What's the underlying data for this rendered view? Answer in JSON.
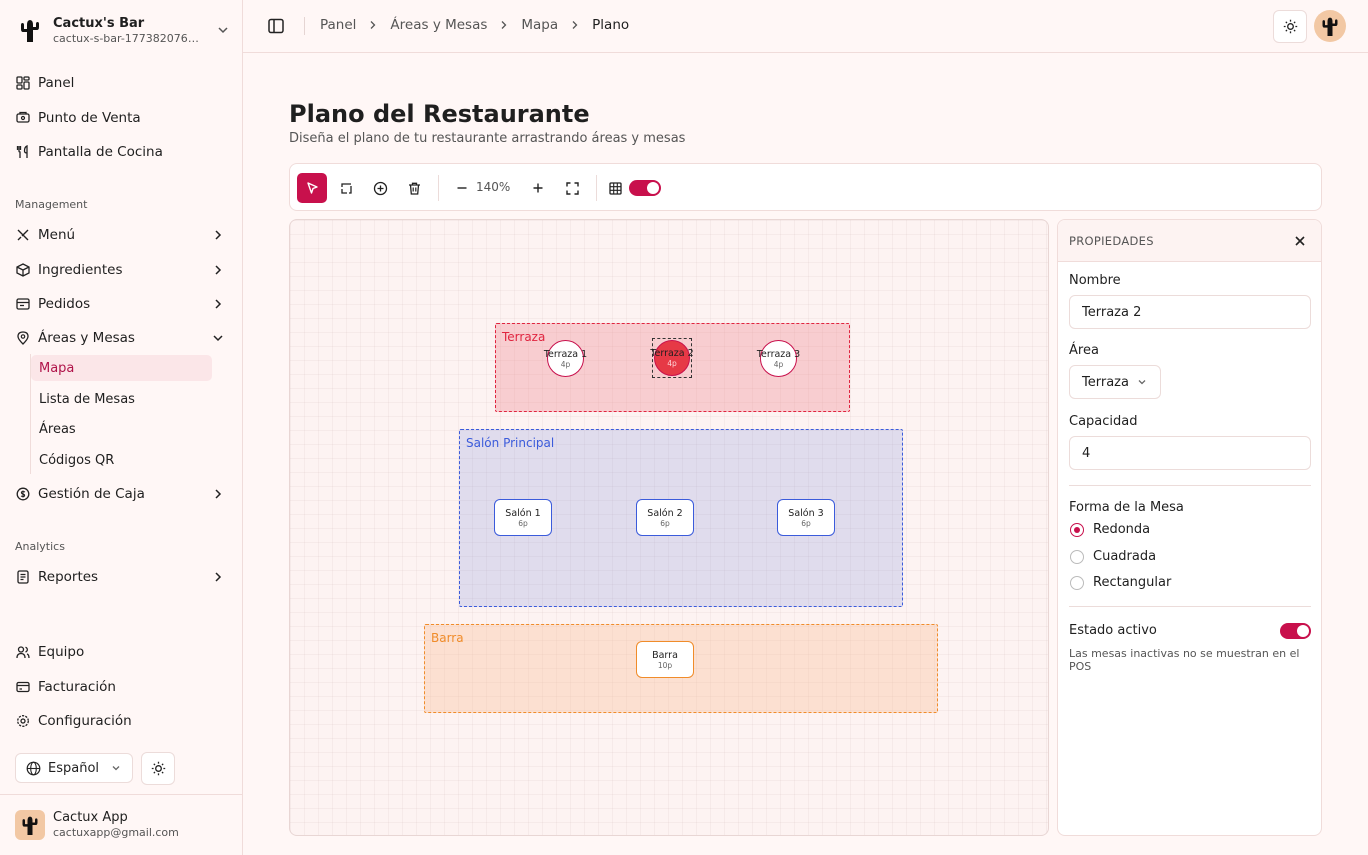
{
  "brand": {
    "name": "Cactux's Bar",
    "slug": "cactux-s-bar-1773820763..."
  },
  "nav": {
    "primary": [
      {
        "label": "Panel",
        "icon": "dashboard-icon"
      },
      {
        "label": "Punto de Venta",
        "icon": "pos-icon"
      },
      {
        "label": "Pantalla de Cocina",
        "icon": "utensils-icon"
      }
    ],
    "management_label": "Management",
    "management": [
      {
        "label": "Menú",
        "icon": "menu-icon"
      },
      {
        "label": "Ingredientes",
        "icon": "box-icon"
      },
      {
        "label": "Pedidos",
        "icon": "receipt-icon"
      },
      {
        "label": "Áreas y Mesas",
        "icon": "map-pin-icon"
      }
    ],
    "areas_sub": [
      {
        "label": "Mapa"
      },
      {
        "label": "Lista de Mesas"
      },
      {
        "label": "Áreas"
      },
      {
        "label": "Códigos QR"
      }
    ],
    "cash": {
      "label": "Gestión de Caja",
      "icon": "cash-icon"
    },
    "analytics_label": "Analytics",
    "reports": {
      "label": "Reportes",
      "icon": "report-icon"
    },
    "bottom": [
      {
        "label": "Equipo",
        "icon": "users-icon"
      },
      {
        "label": "Facturación",
        "icon": "card-icon"
      },
      {
        "label": "Configuración",
        "icon": "gear-icon"
      }
    ]
  },
  "language": "Español",
  "user": {
    "name": "Cactux App",
    "email": "cactuxapp@gmail.com"
  },
  "breadcrumb": [
    "Panel",
    "Áreas y Mesas",
    "Mapa",
    "Plano"
  ],
  "page": {
    "title": "Plano del Restaurante",
    "subtitle": "Diseña el plano de tu restaurante arrastrando áreas y mesas"
  },
  "toolbar": {
    "zoom": "140%",
    "grid_enabled": true
  },
  "floor": {
    "areas": [
      {
        "name": "Terraza",
        "color": "#e0243f"
      },
      {
        "name": "Salón Principal",
        "color": "#3b5bdb"
      },
      {
        "name": "Barra",
        "color": "#f08c2a"
      }
    ],
    "tables": [
      {
        "name": "Terraza 1",
        "capacity": "4p",
        "area": "Terraza",
        "shape": "round"
      },
      {
        "name": "Terraza 2",
        "capacity": "4p",
        "area": "Terraza",
        "shape": "round",
        "selected": true
      },
      {
        "name": "Terraza 3",
        "capacity": "4p",
        "area": "Terraza",
        "shape": "round"
      },
      {
        "name": "Salón 1",
        "capacity": "6p",
        "area": "Salón Principal",
        "shape": "rect"
      },
      {
        "name": "Salón 2",
        "capacity": "6p",
        "area": "Salón Principal",
        "shape": "rect"
      },
      {
        "name": "Salón 3",
        "capacity": "6p",
        "area": "Salón Principal",
        "shape": "rect"
      },
      {
        "name": "Barra",
        "capacity": "10p",
        "area": "Barra",
        "shape": "rect"
      }
    ]
  },
  "properties": {
    "title": "PROPIEDADES",
    "name_label": "Nombre",
    "name_value": "Terraza 2",
    "area_label": "Área",
    "area_value": "Terraza",
    "capacity_label": "Capacidad",
    "capacity_value": "4",
    "shape_label": "Forma de la Mesa",
    "shapes": [
      "Redonda",
      "Cuadrada",
      "Rectangular"
    ],
    "selected_shape": "Redonda",
    "active_label": "Estado activo",
    "active_value": true,
    "active_help": "Las mesas inactivas no se muestran en el POS"
  },
  "colors": {
    "accent": "#c8104c"
  }
}
